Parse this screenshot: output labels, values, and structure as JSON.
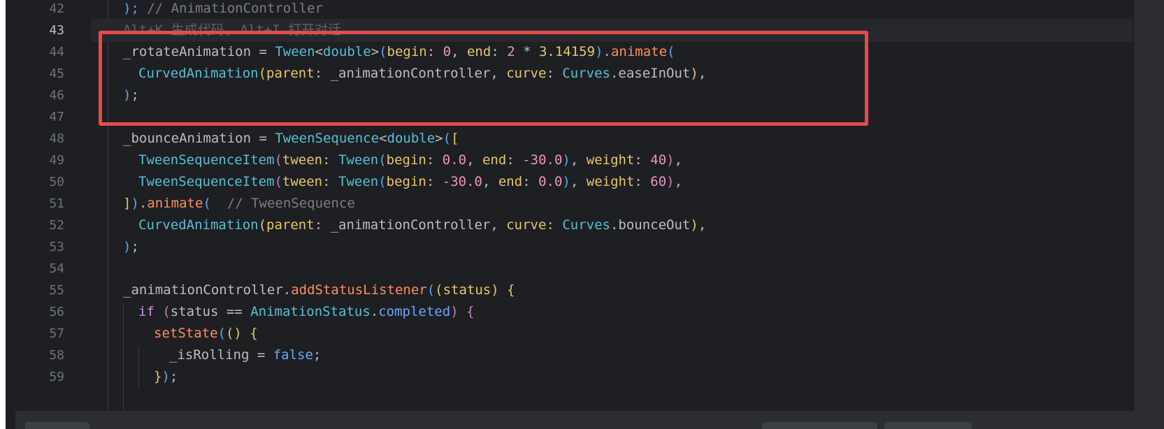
{
  "editor": {
    "line_numbers": [
      "42",
      "43",
      "44",
      "45",
      "46",
      "47",
      "48",
      "49",
      "50",
      "51",
      "52",
      "53",
      "54",
      "55",
      "56",
      "57",
      "58",
      "59"
    ],
    "current_line": "43",
    "inline_hint": "Alt+K 生成代码, Alt+I 打开对话",
    "lines": {
      "l42": {
        "a": ");",
        "b": " // AnimationController"
      },
      "l44": {
        "a": "_rotateAnimation = ",
        "b": "Tween",
        "c": "<",
        "d": "double",
        "e": ">",
        "f": "(",
        "g": "begin",
        "h": ": ",
        "i": "0",
        "j": ", ",
        "k": "end",
        "l": ": ",
        "m": "2",
        "n": " * ",
        "o": "3.14159",
        "p": ")",
        "q": ".",
        "r": "animate",
        "s": "("
      },
      "l45": {
        "a": "CurvedAnimation",
        "b": "(",
        "c": "parent",
        "d": ": _animationController, ",
        "e": "curve",
        "f": ": ",
        "g": "Curves",
        "h": ".easeInOut",
        "i": ")",
        "j": ","
      },
      "l46": {
        "a": ")",
        "b": ";"
      },
      "l48": {
        "a": "_bounceAnimation = ",
        "b": "TweenSequence",
        "c": "<",
        "d": "double",
        "e": ">",
        "f": "(",
        "g": "["
      },
      "l49": {
        "a": "TweenSequenceItem",
        "b": "(",
        "c": "tween",
        "d": ": ",
        "e": "Tween",
        "f": "(",
        "g": "begin",
        "h": ": ",
        "i": "0.0",
        "j": ", ",
        "k": "end",
        "l": ": ",
        "m": "-30.0",
        "n": ")",
        "o": ", ",
        "p": "weight",
        "q": ": ",
        "r": "40",
        "s": ")",
        "t": ","
      },
      "l50": {
        "a": "TweenSequenceItem",
        "b": "(",
        "c": "tween",
        "d": ": ",
        "e": "Tween",
        "f": "(",
        "g": "begin",
        "h": ": ",
        "i": "-30.0",
        "j": ", ",
        "k": "end",
        "l": ": ",
        "m": "0.0",
        "n": ")",
        "o": ", ",
        "p": "weight",
        "q": ": ",
        "r": "60",
        "s": ")",
        "t": ","
      },
      "l51": {
        "a": "]",
        "b": ")",
        "c": ".",
        "d": "animate",
        "e": "(",
        "f": "  // TweenSequence"
      },
      "l52": {
        "a": "CurvedAnimation",
        "b": "(",
        "c": "parent",
        "d": ": _animationController, ",
        "e": "curve",
        "f": ": ",
        "g": "Curves",
        "h": ".bounceOut",
        "i": ")",
        "j": ","
      },
      "l53": {
        "a": ")",
        "b": ";"
      },
      "l55": {
        "a": "_animationController",
        "b": ".",
        "c": "addStatusListener",
        "d": "(",
        "e": "(",
        "f": "status",
        "g": ") ",
        "h": "{"
      },
      "l56": {
        "a": "if",
        "b": " ",
        "c": "(",
        "d": "status == ",
        "e": "AnimationStatus",
        "f": ".",
        "g": "completed",
        "h": ")",
        "i": " ",
        "j": "{"
      },
      "l57": {
        "a": "setState",
        "b": "(",
        "c": "()",
        "d": " ",
        "e": "{"
      },
      "l58": {
        "a": "_isRolling = ",
        "b": "false",
        "c": ";"
      },
      "l59": {
        "a": "}",
        "b": ")",
        "c": ";"
      }
    }
  },
  "colors": {
    "background": "#1e1f22",
    "highlight_box": "#e84a4a",
    "current_line_bg": "#26282e"
  }
}
